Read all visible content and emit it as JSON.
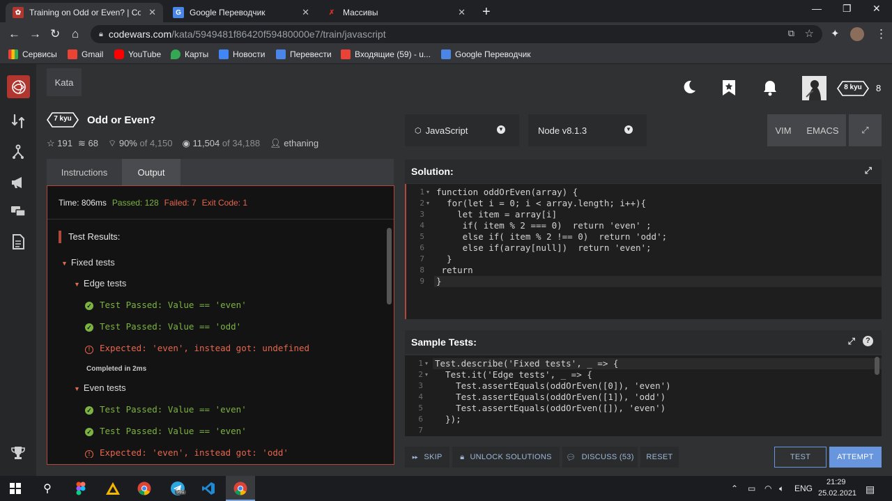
{
  "browser": {
    "tabs": [
      {
        "title": "Training on Odd or Even? | Codewars",
        "active": true
      },
      {
        "title": "Google Переводчик",
        "active": false
      },
      {
        "title": "Массивы",
        "active": false
      }
    ],
    "url_host": "codewars.com",
    "url_path": "/kata/5949481f86420f59480000e7/train/javascript",
    "bookmarks": [
      "Сервисы",
      "Gmail",
      "YouTube",
      "Карты",
      "Новости",
      "Перевести",
      "Входящие (59) - u...",
      "Google Переводчик"
    ]
  },
  "nav": {
    "kata_label": "Kata",
    "rank": "8 kyu",
    "honor": "8"
  },
  "kata": {
    "rank": "7 kyu",
    "title": "Odd or Even?",
    "stars": "191",
    "collections": "68",
    "satisfaction": "90%",
    "satisfaction_of": "of 4,150",
    "completed": "11,504",
    "completed_of": "of 34,188",
    "author": "ethaning"
  },
  "panel_tabs": {
    "instructions": "Instructions",
    "output": "Output"
  },
  "output": {
    "time": "Time: 806ms",
    "passed": "Passed: 128",
    "failed": "Failed: 7",
    "exit_code": "Exit Code: 1",
    "header": "Test Results:",
    "fixed_tests": "Fixed tests",
    "edge_tests": "Edge tests",
    "edge_lines": [
      "Test Passed: Value == 'even'",
      "Test Passed: Value == 'odd'",
      "Expected: 'even', instead got: undefined"
    ],
    "completed_in": "Completed in 2ms",
    "even_tests": "Even tests",
    "even_lines": [
      "Test Passed: Value == 'even'",
      "Test Passed: Value == 'even'",
      "Expected: 'even', instead got: 'odd'"
    ]
  },
  "toolbar": {
    "language": "JavaScript",
    "version": "Node v8.1.3",
    "vim": "VIM",
    "emacs": "EMACS"
  },
  "solution": {
    "title": "Solution:",
    "lines": [
      "function oddOrEven(array) {",
      "  for(let i = 0; i < array.length; i++){",
      "    let item = array[i]",
      "     if( item % 2 === 0)  return 'even' ;",
      "     else if( item % 2 !== 0)  return 'odd';",
      "     else if(array[null])  return 'even';",
      "  }",
      " return",
      "}"
    ]
  },
  "sample_tests": {
    "title": "Sample Tests:",
    "lines": [
      "Test.describe('Fixed tests', _ => {",
      "  Test.it('Edge tests', _ => {",
      "    Test.assertEquals(oddOrEven([0]), 'even')",
      "    Test.assertEquals(oddOrEven([1]), 'odd')",
      "    Test.assertEquals(oddOrEven([]), 'even')",
      "  });",
      ""
    ]
  },
  "buttons": {
    "skip": "SKIP",
    "unlock": "UNLOCK SOLUTIONS",
    "discuss": "DISCUSS (53)",
    "reset": "RESET",
    "test": "TEST",
    "attempt": "ATTEMPT"
  },
  "taskbar": {
    "lang": "ENG",
    "time": "21:29",
    "date": "25.02.2021",
    "telegram_badge": "591"
  },
  "colors": {
    "accent_red": "#b1483c",
    "pass_green": "#7cb342",
    "fail_red": "#e8664d",
    "button_blue": "#6795de"
  }
}
